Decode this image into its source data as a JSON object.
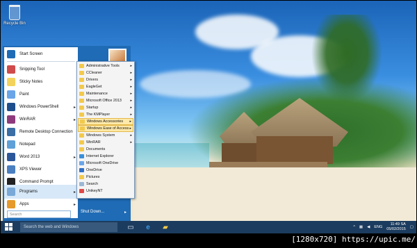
{
  "desktop": {
    "recycle_bin_label": "Recycle Bin"
  },
  "start_menu": {
    "items": [
      {
        "label": "Start Screen",
        "icon": "start-screen-icon",
        "color": "#1f6bb5",
        "arrow": ""
      },
      {
        "label": "Snipping Tool",
        "icon": "scissors-icon",
        "color": "#d04b4b",
        "arrow": ""
      },
      {
        "label": "Sticky Notes",
        "icon": "sticky-note-icon",
        "color": "#f3d35c",
        "arrow": ""
      },
      {
        "label": "Paint",
        "icon": "paint-palette-icon",
        "color": "#6aa5e8",
        "arrow": ""
      },
      {
        "label": "Windows PowerShell",
        "icon": "powershell-icon",
        "color": "#1f4e8c",
        "arrow": "▸"
      },
      {
        "label": "WinRAR",
        "icon": "winrar-icon",
        "color": "#8e3b7d",
        "arrow": "▸"
      },
      {
        "label": "Remote Desktop Connection",
        "icon": "remote-desktop-icon",
        "color": "#3a6ea5",
        "arrow": ""
      },
      {
        "label": "Notepad",
        "icon": "notepad-icon",
        "color": "#5fa0d8",
        "arrow": ""
      },
      {
        "label": "Word 2013",
        "icon": "word-icon",
        "color": "#2b579a",
        "arrow": "▸"
      },
      {
        "label": "XPS Viewer",
        "icon": "xps-viewer-icon",
        "color": "#4a7fc0",
        "arrow": ""
      },
      {
        "label": "Command Prompt",
        "icon": "command-prompt-icon",
        "color": "#222222",
        "arrow": ""
      },
      {
        "label": "Programs",
        "icon": "programs-icon",
        "color": "#7aa9d8",
        "arrow": "▸"
      },
      {
        "label": "Apps",
        "icon": "apps-icon",
        "color": "#e59a2b",
        "arrow": "▸"
      }
    ],
    "search_placeholder": "Search",
    "shutdown_label": "Shut Down...",
    "shutdown_arrow": "▸"
  },
  "programs_submenu": {
    "items": [
      {
        "label": "Administrative Tools",
        "arrow": "▸"
      },
      {
        "label": "CCleaner",
        "arrow": "▸"
      },
      {
        "label": "Drivers",
        "arrow": "▸"
      },
      {
        "label": "EagleGet",
        "arrow": "▸"
      },
      {
        "label": "Maintenance",
        "arrow": "▸"
      },
      {
        "label": "Microsoft Office 2013",
        "arrow": "▸"
      },
      {
        "label": "Startup",
        "arrow": "▸"
      },
      {
        "label": "The KMPlayer",
        "arrow": "▸"
      },
      {
        "label": "Windows Accessories",
        "arrow": "▸"
      },
      {
        "label": "Windows Ease of Access",
        "arrow": "▸"
      },
      {
        "label": "Windows System",
        "arrow": "▸"
      },
      {
        "label": "WinRAR",
        "arrow": "▸"
      },
      {
        "label": "Documents",
        "arrow": ""
      },
      {
        "label": "Internet Explorer",
        "arrow": ""
      },
      {
        "label": "Microsoft OneDrive",
        "arrow": ""
      },
      {
        "label": "OneDrive",
        "arrow": ""
      },
      {
        "label": "Pictures",
        "arrow": ""
      },
      {
        "label": "Search",
        "arrow": ""
      },
      {
        "label": "UnikeyNT",
        "arrow": ""
      }
    ]
  },
  "taskbar": {
    "search_placeholder": "Search the web and Windows",
    "tray_language": "ENG",
    "clock_time": "11:49 SA",
    "clock_date": "05/02/2015"
  },
  "caption": "[1280x720] https://upic.me/"
}
